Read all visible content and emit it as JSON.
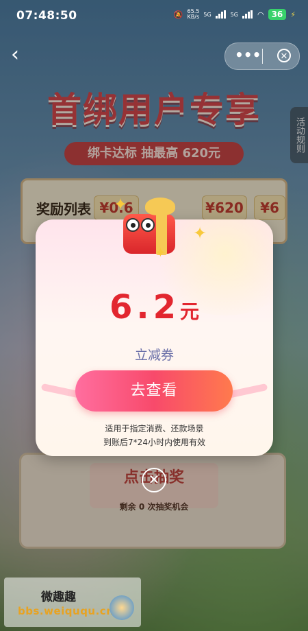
{
  "status_bar": {
    "time": "07:48:50",
    "net_speed": "65.5\nKB/s",
    "sig1": "5G",
    "sig2": "5G",
    "battery": "36"
  },
  "nav": {
    "back_icon": "chevron-left-icon",
    "more_icon": "more-dots-icon",
    "close_icon": "close-circle-icon"
  },
  "page": {
    "title": "首绑用户专享",
    "subtitle": "绑卡达标 抽最高 620元",
    "rules_tab": "活动规则",
    "reward_label": "奖励列表",
    "reward_chips": [
      "¥0.6",
      "¥620",
      "¥6"
    ],
    "draw_button": "点击抽奖",
    "draw_remaining": "剩余 0 次抽奖机会"
  },
  "modal": {
    "amount": "6.2",
    "unit": "元",
    "coupon_type": "立减券",
    "view_button": "去查看",
    "note_line1": "适用于指定消费、还款场景",
    "note_line2": "到账后7*24小时内使用有效",
    "close_icon": "close-icon"
  },
  "watermark": {
    "line1": "微趣趣",
    "line2": "bbs.weiququ.cn"
  },
  "colors": {
    "accent_red": "#e2262f",
    "button_pink": "#f84a6b",
    "coupon_text": "#6a6fa8"
  }
}
